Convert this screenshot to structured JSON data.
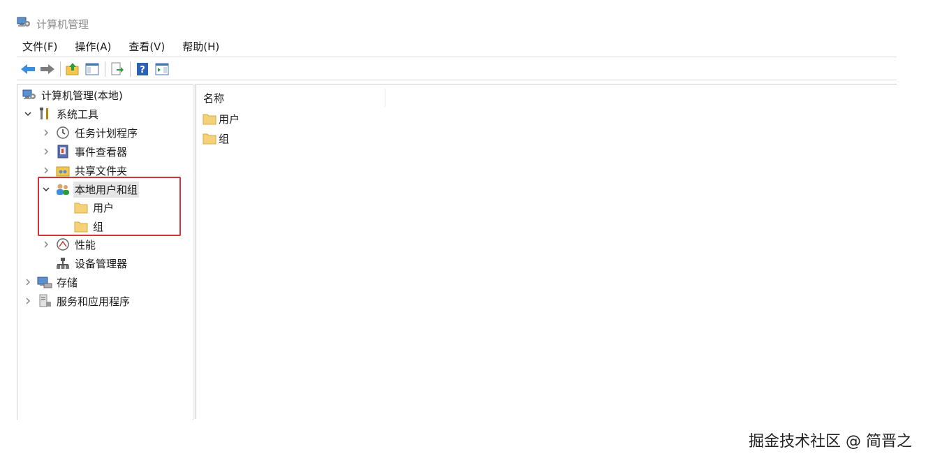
{
  "window": {
    "title": "计算机管理"
  },
  "menu": [
    {
      "label": "文件(F)"
    },
    {
      "label": "操作(A)"
    },
    {
      "label": "查看(V)"
    },
    {
      "label": "帮助(H)"
    }
  ],
  "toolbar": {
    "buttons": [
      "back-arrow-icon",
      "forward-arrow-icon",
      "up-folder-icon",
      "show-hide-tree-icon",
      "export-list-icon",
      "help-icon",
      "action-pane-icon"
    ]
  },
  "tree": {
    "root": "计算机管理(本地)",
    "system_tools": "系统工具",
    "task_scheduler": "任务计划程序",
    "event_viewer": "事件查看器",
    "shared_folders": "共享文件夹",
    "local_users_groups": "本地用户和组",
    "users": "用户",
    "groups": "组",
    "performance": "性能",
    "device_manager": "设备管理器",
    "storage": "存储",
    "services_apps": "服务和应用程序"
  },
  "list": {
    "column_name": "名称",
    "items": [
      "用户",
      "组"
    ]
  },
  "watermark": "掘金技术社区 @ 简晋之",
  "colors": {
    "highlight": "#d2323c",
    "selection": "#e5e5e5",
    "folder": "#f5d27a"
  }
}
